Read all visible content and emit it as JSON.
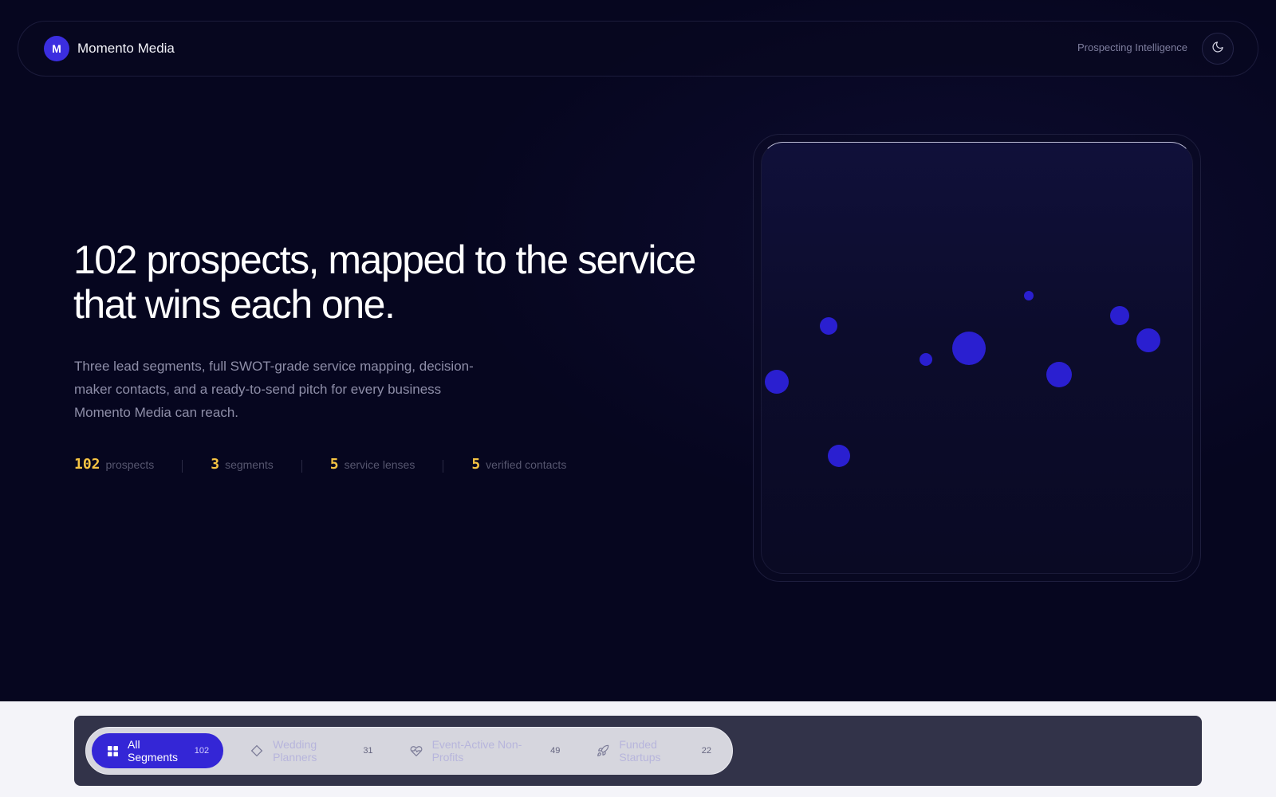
{
  "nav": {
    "brand_initial": "M",
    "brand_name": "Momento Media",
    "tagline": "Prospecting Intelligence",
    "theme_icon": "moon-icon"
  },
  "hero": {
    "headline_line1": "102 prospects, mapped to the service",
    "headline_line2": "that wins each one.",
    "description": "Three lead segments, full SWOT-grade service mapping, decision-maker contacts, and a ready-to-send pitch for every business Momento Media can reach."
  },
  "stats": [
    {
      "value": "102",
      "label": "prospects"
    },
    {
      "value": "3",
      "label": "segments"
    },
    {
      "value": "5",
      "label": "service lenses"
    },
    {
      "value": "5",
      "label": "verified contacts"
    }
  ],
  "visual": {
    "dot_color": "#2a1fd0"
  },
  "filters": [
    {
      "label": "All Segments",
      "count": "102",
      "icon": "grid-icon",
      "active": true
    },
    {
      "label": "Wedding Planners",
      "count": "31",
      "icon": "diamond-icon",
      "active": false
    },
    {
      "label": "Event-Active Non-Profits",
      "count": "49",
      "icon": "heart-pulse-icon",
      "active": false
    },
    {
      "label": "Funded Startups",
      "count": "22",
      "icon": "rocket-icon",
      "active": false
    }
  ],
  "colors": {
    "accent": "#3426d6",
    "highlight": "#f6c443",
    "background": "#06061f"
  }
}
